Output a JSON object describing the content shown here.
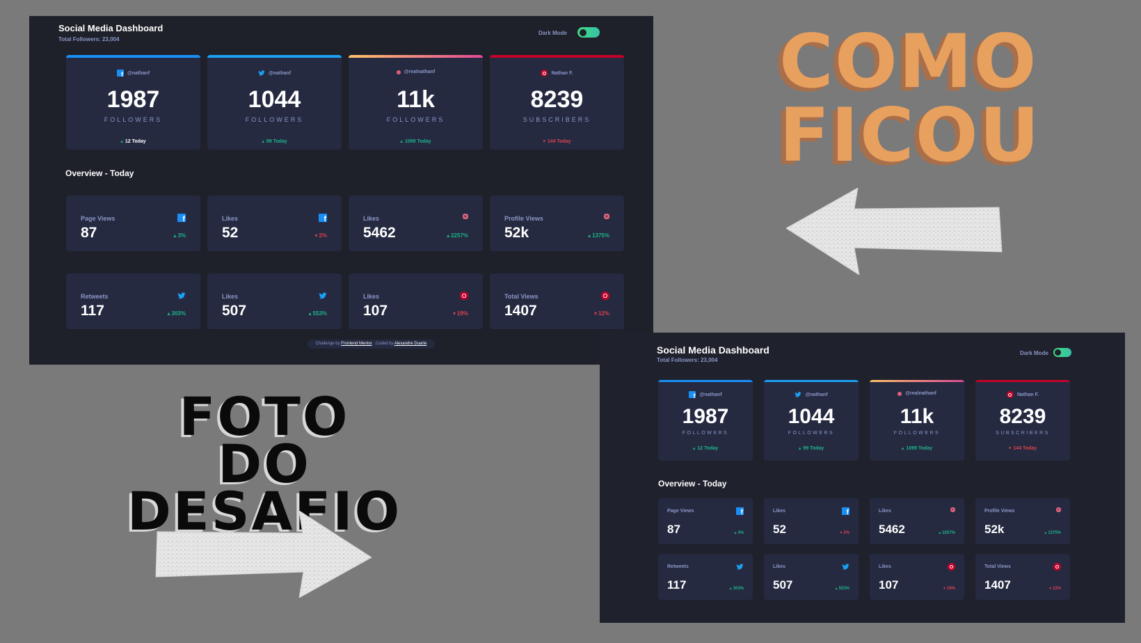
{
  "dashboard": {
    "title": "Social Media Dashboard",
    "total_followers": "Total Followers: 23,004",
    "dark_mode_label": "Dark Mode"
  },
  "cards": [
    {
      "network": "facebook",
      "handle": "@nathanf",
      "count": "1987",
      "unit": "FOLLOWERS",
      "today": "12 Today",
      "trend": "up",
      "accent": "#198ff5"
    },
    {
      "network": "twitter",
      "handle": "@nathanf",
      "count": "1044",
      "unit": "FOLLOWERS",
      "today": "99 Today",
      "trend": "up",
      "accent": "#1ca0f2"
    },
    {
      "network": "instagram",
      "handle": "@realnathanf",
      "count": "11k",
      "unit": "FOLLOWERS",
      "today": "1099 Today",
      "trend": "up",
      "accent": "#e0647c"
    },
    {
      "network": "youtube",
      "handle": "Nathan F.",
      "count": "8239",
      "unit": "SUBSCRIBERS",
      "today": "144 Today",
      "trend": "down",
      "accent": "#c4032a"
    }
  ],
  "overview": {
    "title": "Overview - Today",
    "items": [
      {
        "label": "Page Views",
        "value": "87",
        "change": "3%",
        "trend": "up",
        "icon": "facebook-icon"
      },
      {
        "label": "Likes",
        "value": "52",
        "change": "2%",
        "trend": "down",
        "icon": "facebook-icon"
      },
      {
        "label": "Likes",
        "value": "5462",
        "change": "2257%",
        "trend": "up",
        "icon": "instagram-icon"
      },
      {
        "label": "Profile Views",
        "value": "52k",
        "change": "1375%",
        "trend": "up",
        "icon": "instagram-icon"
      },
      {
        "label": "Retweets",
        "value": "117",
        "change": "303%",
        "trend": "up",
        "icon": "twitter-icon"
      },
      {
        "label": "Likes",
        "value": "507",
        "change": "553%",
        "trend": "up",
        "icon": "twitter-icon"
      },
      {
        "label": "Likes",
        "value": "107",
        "change": "19%",
        "trend": "down",
        "icon": "youtube-icon"
      },
      {
        "label": "Total Views",
        "value": "1407",
        "change": "12%",
        "trend": "down",
        "icon": "youtube-icon"
      }
    ]
  },
  "footer": {
    "challenge_by": "Challenge by",
    "frontend_mentor": "Frontend Mentor",
    "coded_by": ". Coded by",
    "author": "Alexandre Duarte"
  },
  "overlay": {
    "como_line1": "COMO",
    "como_line2": "FICOU",
    "desafio_line1": "FOTO DO",
    "desafio_line2": "DESAFIO"
  },
  "colors": {
    "background": "#7a7a7a",
    "panel": "#1e202a",
    "card": "#252a41",
    "up": "#1db489",
    "down": "#dc414c",
    "accent_orange": "#e8a05e"
  }
}
